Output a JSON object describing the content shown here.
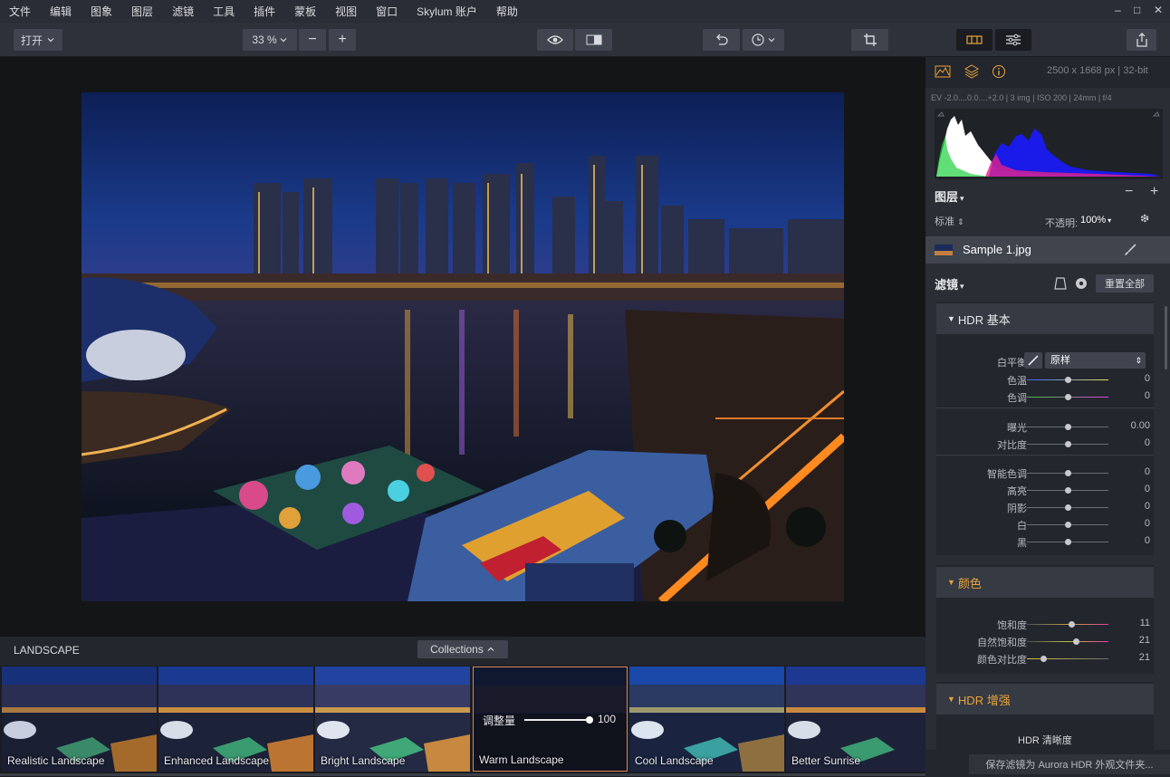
{
  "menu": [
    "文件",
    "编辑",
    "图象",
    "图层",
    "滤镜",
    "工具",
    "插件",
    "蒙板",
    "视图",
    "窗口",
    "Skylum 账户",
    "帮助"
  ],
  "window_controls": {
    "minimize": "–",
    "maximize": "□",
    "close": "✕"
  },
  "toolbar": {
    "open_label": "打开",
    "zoom": "33 %",
    "zoom_out": "−",
    "zoom_in": "+"
  },
  "image_info": {
    "dimensions": "2500 x 1668 px | 32-bit",
    "exif": "EV -2.0....0.0....+2.0 | 3 img | ISO 200 | 24mm | f/4"
  },
  "layers": {
    "title": "图层",
    "blend_mode": "标准",
    "opacity_label": "不透明:",
    "opacity_value": "100%",
    "layer_name": "Sample 1.jpg",
    "minus": "−",
    "plus": "+"
  },
  "filters": {
    "title": "滤镜",
    "reset_all": "重置全部"
  },
  "hdr_basic": {
    "title": "HDR 基本",
    "white_balance_label": "白平衡",
    "white_balance_value": "原样",
    "rows": [
      {
        "label": "色温",
        "value": "0",
        "pos": 0.5
      },
      {
        "label": "色调",
        "value": "0",
        "pos": 0.5
      },
      {
        "label": "曝光",
        "value": "0.00",
        "pos": 0.5
      },
      {
        "label": "对比度",
        "value": "0",
        "pos": 0.5
      },
      {
        "label": "智能色调",
        "value": "0",
        "pos": 0.5
      },
      {
        "label": "高亮",
        "value": "0",
        "pos": 0.5
      },
      {
        "label": "阴影",
        "value": "0",
        "pos": 0.5
      },
      {
        "label": "白",
        "value": "0",
        "pos": 0.5
      },
      {
        "label": "黑",
        "value": "0",
        "pos": 0.5
      }
    ]
  },
  "color": {
    "title": "颜色",
    "rows": [
      {
        "label": "饱和度",
        "value": "11",
        "pos": 0.555
      },
      {
        "label": "自然饱和度",
        "value": "21",
        "pos": 0.605
      },
      {
        "label": "颜色对比度",
        "value": "21",
        "pos": 0.21
      }
    ]
  },
  "hdr_enhance": {
    "title": "HDR 增强",
    "first_row": "HDR 清晰度"
  },
  "save_filters": "保存滤镜为 Aurora HDR 外观文件夹...",
  "collections": {
    "category": "LANDSCAPE",
    "button": "Collections",
    "amount_label": "调整量",
    "amount_value": "100",
    "amount_level": 1.0,
    "presets": [
      "Realistic Landscape",
      "Enhanced Landscape",
      "Bright Landscape",
      "Warm Landscape",
      "Cool Landscape",
      "Better Sunrise"
    ]
  },
  "colors": {
    "accent": "#e8a33c",
    "active_preset_border": "#d9885a"
  }
}
